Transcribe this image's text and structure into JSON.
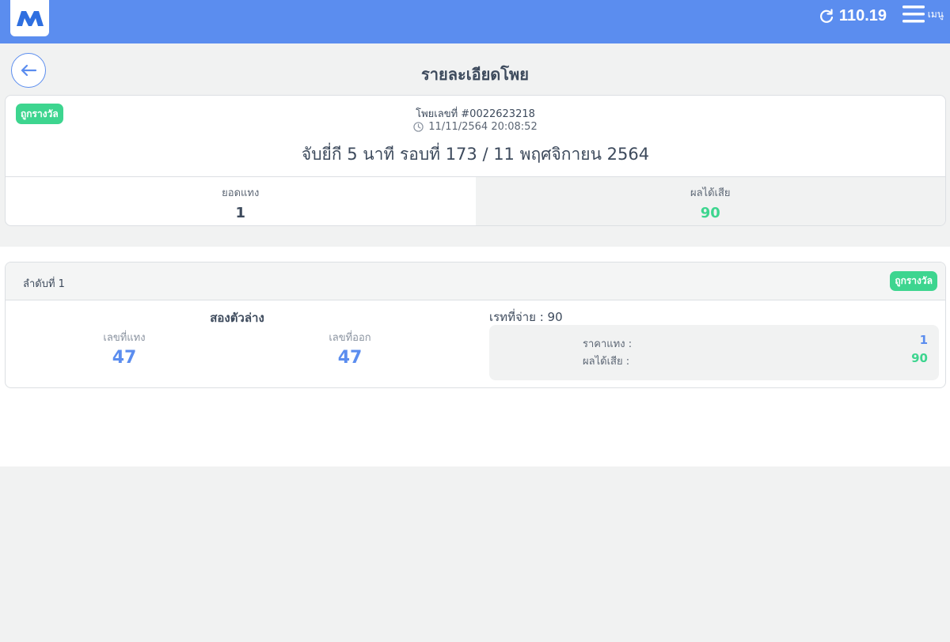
{
  "header": {
    "balance": "110.19",
    "menu_label": "เมนู"
  },
  "page": {
    "title": "รายละเอียดโพย"
  },
  "ticket": {
    "status_badge": "ถูกรางวัล",
    "number": "โพยเลขที่ #0022623218",
    "datetime": "11/11/2564 20:08:52",
    "round": "จับยี่กี 5 นาที รอบที่ 173 / 11 พฤศจิกายน 2564",
    "bet_total_label": "ยอดแทง",
    "bet_total_value": "1",
    "result_label": "ผลได้เสีย",
    "result_value": "90"
  },
  "order": {
    "label": "ลำดับที่ 1",
    "status_badge": "ถูกรางวัล",
    "bet_type": "สองตัวล่าง",
    "bet_number_label": "เลขที่แทง",
    "bet_number_value": "47",
    "draw_number_label": "เลขที่ออก",
    "draw_number_value": "47",
    "rate_text": "เรทที่จ่าย : 90",
    "price_label": "ราคาแทง :",
    "price_value": "1",
    "result_label": "ผลได้เสีย :",
    "result_value": "90"
  },
  "colors": {
    "primary": "#5b8def",
    "success": "#3dd58f",
    "text": "#3d4a5c"
  }
}
